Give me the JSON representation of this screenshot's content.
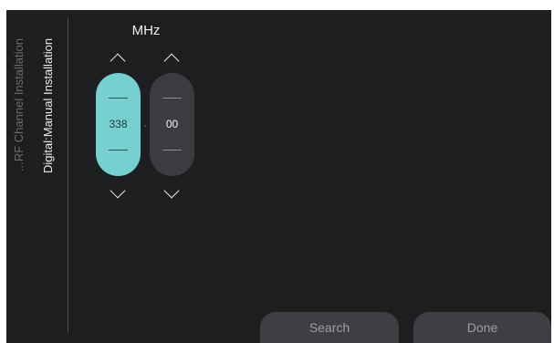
{
  "breadcrumb": {
    "previous": "...RF Channel Installation",
    "current": "Digital:Manual Installation"
  },
  "frequency": {
    "unit": "MHz",
    "mhz_value": "338",
    "separator": ".",
    "khz_value": "00"
  },
  "actions": {
    "search_label": "Search",
    "done_label": "Done"
  },
  "colors": {
    "background": "#1d1e20",
    "active_spinner": "#77d0d0",
    "inactive_spinner": "#3b3c3f",
    "button": "#3d3f42"
  },
  "icons": {
    "increment": "chevron-up-icon",
    "decrement": "chevron-down-icon"
  }
}
